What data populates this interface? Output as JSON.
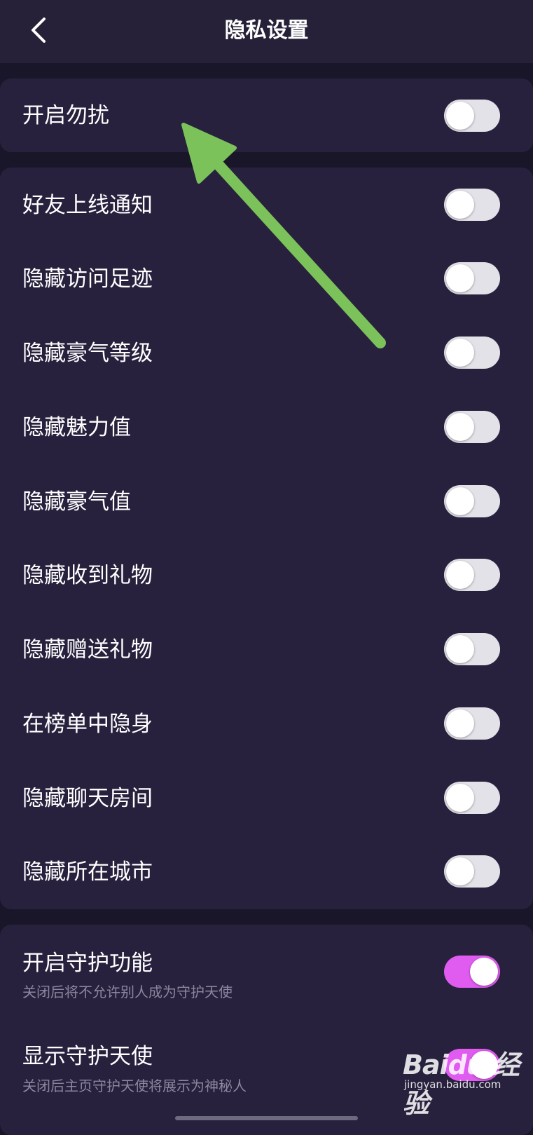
{
  "header": {
    "title": "隐私设置",
    "back_icon": "chevron-left-icon"
  },
  "dnd": {
    "label": "开启勿扰",
    "on": false
  },
  "privacy_items": [
    {
      "label": "好友上线通知",
      "on": false
    },
    {
      "label": "隐藏访问足迹",
      "on": false
    },
    {
      "label": "隐藏豪气等级",
      "on": false
    },
    {
      "label": "隐藏魅力值",
      "on": false
    },
    {
      "label": "隐藏豪气值",
      "on": false
    },
    {
      "label": "隐藏收到礼物",
      "on": false
    },
    {
      "label": "隐藏赠送礼物",
      "on": false
    },
    {
      "label": "在榜单中隐身",
      "on": false
    },
    {
      "label": "隐藏聊天房间",
      "on": false
    },
    {
      "label": "隐藏所在城市",
      "on": false
    }
  ],
  "guard_items": [
    {
      "label": "开启守护功能",
      "sub": "关闭后将不允许别人成为守护天使",
      "on": true
    },
    {
      "label": "显示守护天使",
      "sub": "关闭后主页守护天使将展示为神秘人",
      "on": true
    }
  ],
  "watermark": {
    "main": "Baidu 经验",
    "sub": "jingyan.baidu.com"
  },
  "colors": {
    "background": "#1a1629",
    "card": "#28213e",
    "toggle_off": "#e3e2e8",
    "toggle_on": "#e05bf0",
    "annotation_arrow": "#7cc25a"
  }
}
